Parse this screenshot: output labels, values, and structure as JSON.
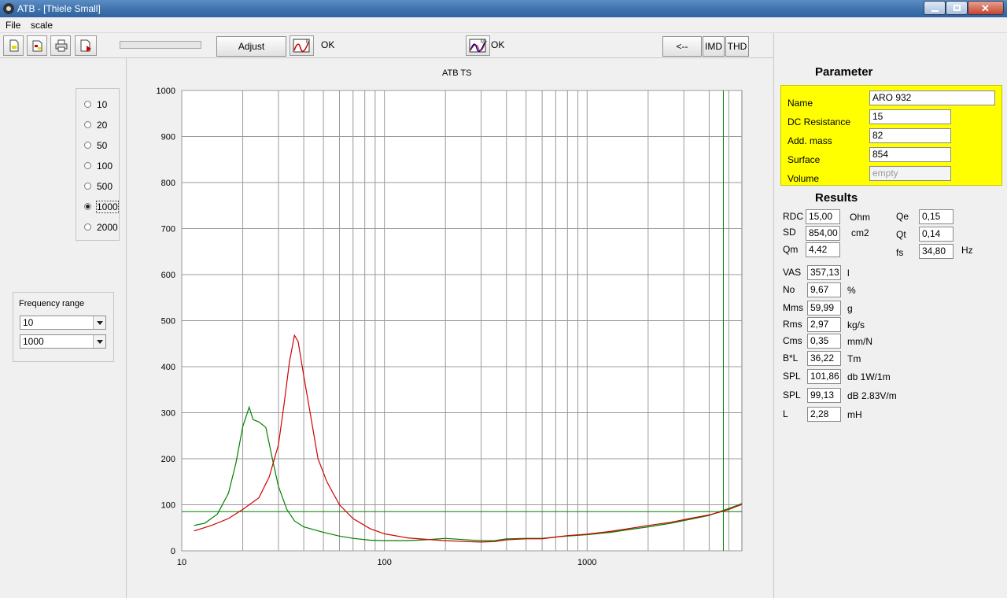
{
  "window": {
    "title": "ATB - [Thiele Small]"
  },
  "menu": [
    "File",
    "scale"
  ],
  "toolbar": {
    "adjust_label": "Adjust",
    "status1": "OK",
    "status2": "OK",
    "back_label": "<--",
    "imd_label": "IMD",
    "thd_label": "THD"
  },
  "scale_options": [
    "10",
    "20",
    "50",
    "100",
    "500",
    "1000",
    "2000"
  ],
  "scale_selected": "1000",
  "frequency_range": {
    "label": "Frequency range",
    "from": "10",
    "to": "1000"
  },
  "parameter": {
    "heading": "Parameter",
    "fields": [
      {
        "label": "Name",
        "value": "ARO 932"
      },
      {
        "label": "DC Resistance",
        "value": "15"
      },
      {
        "label": "Add. mass",
        "value": "82"
      },
      {
        "label": "Surface",
        "value": "854"
      },
      {
        "label": "Volume",
        "value": "empty"
      }
    ]
  },
  "results": {
    "heading": "Results",
    "rdc": {
      "label": "RDC",
      "value": "15,00",
      "unit": "Ohm"
    },
    "sd": {
      "label": "SD",
      "value": "854,00",
      "unit": "cm2"
    },
    "qm": {
      "label": "Qm",
      "value": "4,42"
    },
    "qe": {
      "label": "Qe",
      "value": "0,15"
    },
    "qt": {
      "label": "Qt",
      "value": "0,14"
    },
    "fs": {
      "label": "fs",
      "value": "34,80",
      "unit": "Hz"
    },
    "rows": [
      {
        "label": "VAS",
        "value": "357,13",
        "unit": "l"
      },
      {
        "label": "No",
        "value": "9,67",
        "unit": "%"
      },
      {
        "label": "Mms",
        "value": "59,99",
        "unit": "g"
      },
      {
        "label": "Rms",
        "value": "2,97",
        "unit": "kg/s"
      },
      {
        "label": "Cms",
        "value": "0,35",
        "unit": "mm/N"
      },
      {
        "label": "B*L",
        "value": "36,22",
        "unit": "Tm"
      },
      {
        "label": "SPL",
        "value": "101,86",
        "unit": "db 1W/1m"
      },
      {
        "label": "SPL",
        "value": "99,13",
        "unit": "dB 2.83V/m"
      },
      {
        "label": "L",
        "value": "2,28",
        "unit": "mH"
      }
    ]
  },
  "chart_data": {
    "type": "line",
    "title": "ATB TS",
    "xscale": "log",
    "xlim": [
      10,
      5800
    ],
    "ylim": [
      0,
      1000
    ],
    "grid": true,
    "x_ticks": [
      "10",
      "100",
      "1000"
    ],
    "y_ticks": [
      "0",
      "100",
      "200",
      "300",
      "400",
      "500",
      "600",
      "700",
      "800",
      "900",
      "1000"
    ],
    "series": [
      {
        "color": "#008000",
        "points": [
          [
            11.5,
            55
          ],
          [
            13,
            60
          ],
          [
            15,
            80
          ],
          [
            17,
            125
          ],
          [
            18.5,
            190
          ],
          [
            20,
            270
          ],
          [
            21.5,
            312
          ],
          [
            22.5,
            285
          ],
          [
            24,
            280
          ],
          [
            26,
            268
          ],
          [
            28,
            200
          ],
          [
            30,
            140
          ],
          [
            33,
            90
          ],
          [
            36,
            65
          ],
          [
            40,
            52
          ],
          [
            50,
            40
          ],
          [
            60,
            32
          ],
          [
            70,
            27
          ],
          [
            85,
            23
          ],
          [
            100,
            22
          ],
          [
            130,
            22
          ],
          [
            160,
            24
          ],
          [
            200,
            27
          ],
          [
            250,
            24
          ],
          [
            300,
            22
          ],
          [
            350,
            22
          ],
          [
            400,
            26
          ],
          [
            500,
            27
          ],
          [
            600,
            27
          ],
          [
            700,
            30
          ],
          [
            800,
            32
          ],
          [
            1000,
            35
          ],
          [
            1300,
            40
          ],
          [
            1600,
            46
          ],
          [
            2000,
            52
          ],
          [
            2600,
            60
          ],
          [
            3200,
            68
          ],
          [
            4000,
            77
          ],
          [
            4500,
            85
          ],
          [
            5000,
            92
          ],
          [
            6000,
            105
          ],
          [
            7000,
            115
          ]
        ]
      },
      {
        "color": "#d00000",
        "points": [
          [
            11.5,
            43
          ],
          [
            14,
            55
          ],
          [
            17,
            70
          ],
          [
            20,
            90
          ],
          [
            24,
            115
          ],
          [
            27,
            160
          ],
          [
            30,
            230
          ],
          [
            32,
            320
          ],
          [
            34,
            410
          ],
          [
            36,
            468
          ],
          [
            37.5,
            455
          ],
          [
            40,
            380
          ],
          [
            43,
            300
          ],
          [
            47,
            200
          ],
          [
            52,
            150
          ],
          [
            60,
            100
          ],
          [
            70,
            70
          ],
          [
            85,
            48
          ],
          [
            100,
            37
          ],
          [
            130,
            28
          ],
          [
            160,
            25
          ],
          [
            200,
            22
          ],
          [
            250,
            20
          ],
          [
            300,
            19
          ],
          [
            350,
            20
          ],
          [
            400,
            24
          ],
          [
            500,
            26
          ],
          [
            600,
            26
          ],
          [
            700,
            30
          ],
          [
            800,
            33
          ],
          [
            1000,
            36
          ],
          [
            1300,
            42
          ],
          [
            1600,
            48
          ],
          [
            2000,
            55
          ],
          [
            2600,
            62
          ],
          [
            3200,
            70
          ],
          [
            4000,
            78
          ],
          [
            4500,
            84
          ],
          [
            5000,
            90
          ],
          [
            6000,
            103
          ],
          [
            7000,
            118
          ]
        ]
      }
    ],
    "reference_lines": {
      "horizontal_y": 85,
      "vertical_x": 4700,
      "color": "#008000"
    }
  }
}
